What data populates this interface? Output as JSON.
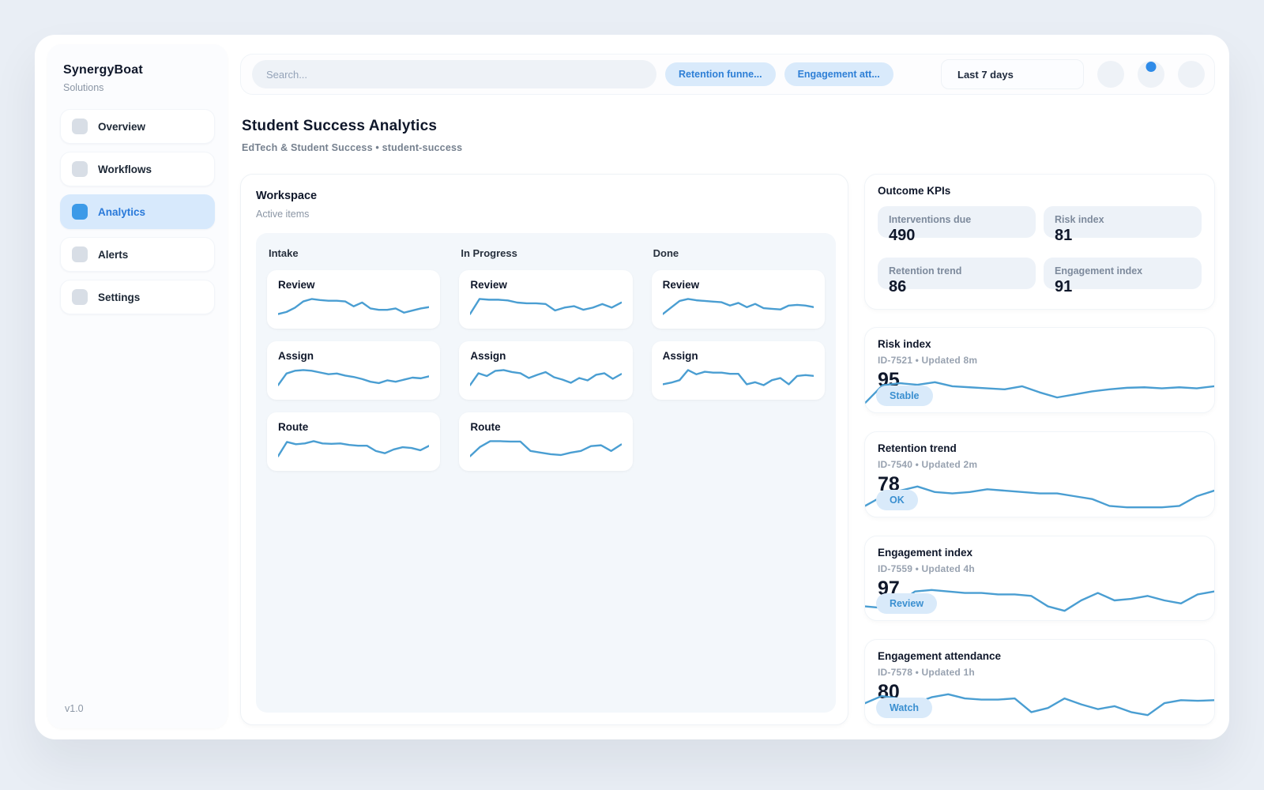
{
  "colors": {
    "accent": "#3c9ae8",
    "spark": "#4a9ed2",
    "chip_bg": "#d9eafb",
    "chip_text": "#2e7fd6",
    "badge_bg": "#d9eafa",
    "badge_text": "#3a8fd0"
  },
  "brand": {
    "name": "SynergyBoat",
    "tagline": "Solutions",
    "version": "v1.0"
  },
  "sidebar": {
    "items": [
      {
        "label": "Overview"
      },
      {
        "label": "Workflows"
      },
      {
        "label": "Analytics"
      },
      {
        "label": "Alerts"
      },
      {
        "label": "Settings"
      }
    ]
  },
  "topbar": {
    "search_placeholder": "Search...",
    "chips": [
      {
        "label": "Retention funne..."
      },
      {
        "label": "Engagement att..."
      }
    ],
    "date_range": "Last 7 days"
  },
  "page": {
    "title": "Student Success Analytics",
    "subtitle": "EdTech & Student Success • student-success"
  },
  "workspace": {
    "title": "Workspace",
    "subtitle": "Active items",
    "columns": [
      {
        "title": "Intake",
        "cards": [
          {
            "title": "Review",
            "spark": [
              22,
              28,
              40,
              58,
              65,
              62,
              60,
              60,
              58,
              44,
              55,
              38,
              34,
              34,
              38,
              26,
              32,
              38,
              42
            ]
          },
          {
            "title": "Assign",
            "spark": [
              18,
              52,
              60,
              62,
              60,
              55,
              50,
              52,
              46,
              42,
              36,
              28,
              24,
              32,
              28,
              34,
              40,
              38,
              44
            ]
          },
          {
            "title": "Route",
            "spark": [
              12,
              50,
              44,
              46,
              52,
              46,
              45,
              46,
              42,
              40,
              40,
              26,
              20,
              30,
              36,
              34,
              28,
              40
            ]
          }
        ]
      },
      {
        "title": "In Progress",
        "cards": [
          {
            "title": "Review",
            "spark": [
              18,
              60,
              58,
              58,
              56,
              50,
              48,
              48,
              46,
              28,
              36,
              40,
              30,
              36,
              46,
              36,
              50
            ]
          },
          {
            "title": "Assign",
            "spark": [
              22,
              52,
              45,
              58,
              60,
              55,
              52,
              40,
              48,
              55,
              42,
              36,
              28,
              40,
              34,
              48,
              52,
              38,
              50
            ]
          },
          {
            "title": "Route",
            "spark": [
              15,
              38,
              52,
              52,
              51,
              51,
              28,
              24,
              20,
              18,
              24,
              28,
              40,
              42,
              28,
              44
            ]
          }
        ]
      },
      {
        "title": "Done",
        "cards": [
          {
            "title": "Review",
            "spark": [
              12,
              32,
              52,
              58,
              54,
              52,
              50,
              48,
              38,
              46,
              33,
              43,
              30,
              28,
              26,
              38,
              40,
              38,
              33
            ]
          },
          {
            "title": "Assign",
            "spark": [
              18,
              22,
              28,
              52,
              42,
              48,
              46,
              46,
              43,
              43,
              18,
              23,
              16,
              28,
              33,
              18,
              38,
              40,
              38
            ]
          }
        ]
      }
    ]
  },
  "kpis": {
    "title": "Outcome KPIs",
    "tiles": [
      {
        "label": "Interventions due",
        "value": "490"
      },
      {
        "label": "Risk index",
        "value": "81"
      },
      {
        "label": "Retention trend",
        "value": "86"
      },
      {
        "label": "Engagement index",
        "value": "91"
      }
    ]
  },
  "metric_cards": [
    {
      "title": "Risk index",
      "meta": "ID-7521 • Updated 8m",
      "value": "95",
      "badge": "Stable",
      "spark": [
        15,
        50,
        54,
        51,
        56,
        48,
        46,
        44,
        42,
        48,
        36,
        26,
        32,
        38,
        42,
        45,
        46,
        44,
        46,
        44,
        48
      ]
    },
    {
      "title": "Retention trend",
      "meta": "ID-7540 • Updated 2m",
      "value": "78",
      "badge": "OK",
      "spark": [
        28,
        42,
        50,
        56,
        48,
        46,
        48,
        52,
        50,
        48,
        46,
        46,
        42,
        38,
        28,
        26,
        26,
        26,
        28,
        42,
        50
      ]
    },
    {
      "title": "Engagement index",
      "meta": "ID-7559 • Updated 4h",
      "value": "97",
      "badge": "Review",
      "spark": [
        32,
        30,
        36,
        52,
        54,
        52,
        50,
        50,
        48,
        48,
        46,
        32,
        26,
        40,
        50,
        40,
        42,
        46,
        40,
        36,
        48,
        52
      ]
    },
    {
      "title": "Engagement attendance",
      "meta": "ID-7578 • Updated 1h",
      "value": "80",
      "badge": "Watch",
      "spark": [
        38,
        50,
        46,
        38,
        48,
        53,
        46,
        44,
        44,
        46,
        23,
        30,
        46,
        36,
        28,
        33,
        23,
        18,
        38,
        43,
        42,
        43
      ]
    }
  ]
}
